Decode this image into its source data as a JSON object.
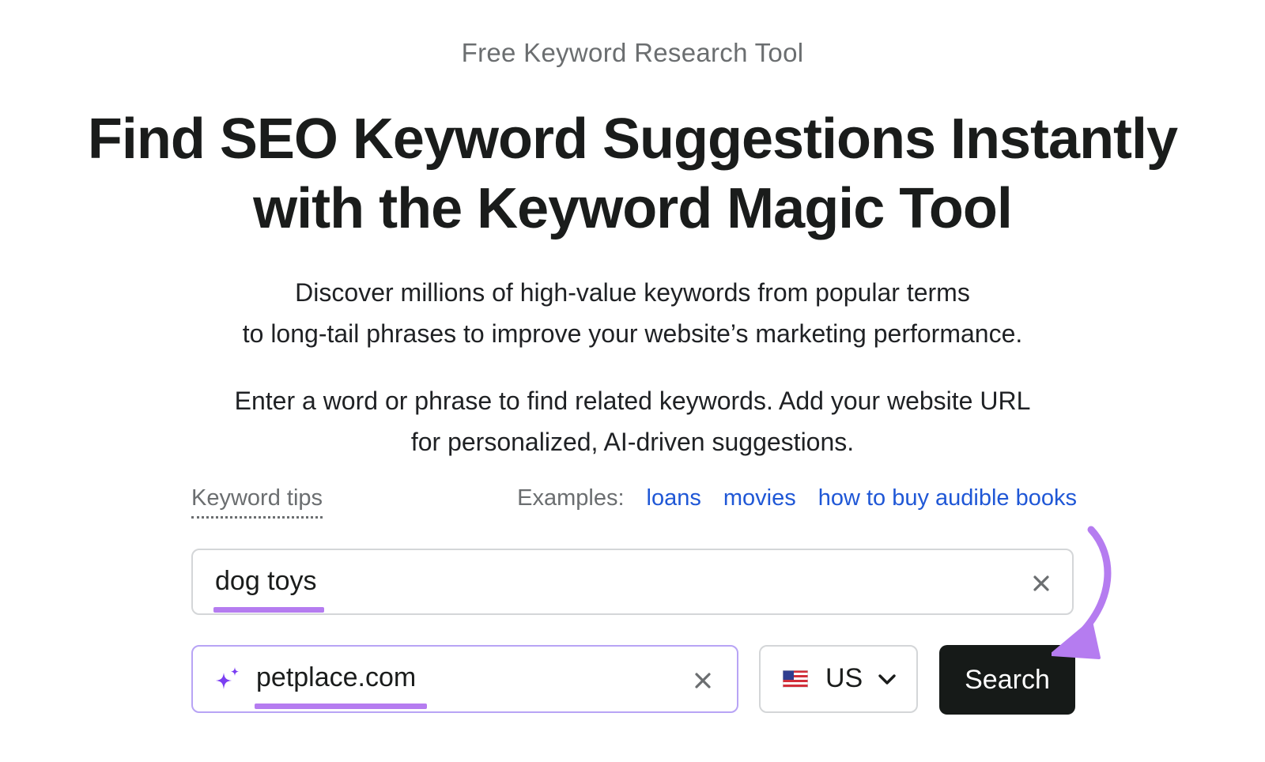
{
  "header": {
    "eyebrow": "Free Keyword Research Tool",
    "headline_line1": "Find SEO Keyword Suggestions Instantly",
    "headline_line2": "with the Keyword Magic Tool",
    "description_line1": "Discover millions of high-value keywords from popular terms",
    "description_line2": "to long-tail phrases to improve your website’s marketing performance.",
    "instruction_line1": "Enter a word or phrase to find related keywords. Add your website URL",
    "instruction_line2": "for personalized, AI-driven suggestions."
  },
  "tips": {
    "keyword_tips_label": "Keyword tips",
    "examples_label": "Examples:",
    "examples": [
      "loans",
      "movies",
      "how to buy audible books"
    ]
  },
  "form": {
    "keyword_value": "dog toys",
    "url_value": "petplace.com",
    "country_value": "US",
    "search_label": "Search",
    "icons": {
      "clear": "close-icon",
      "ai": "sparkle-icon",
      "flag": "us-flag-icon",
      "dropdown": "chevron-down-icon"
    }
  },
  "colors": {
    "accent_purple": "#b57cf0",
    "link_blue": "#1f57d6",
    "button_dark": "#161a18",
    "focus_border": "#b8a4f5",
    "sparkle": "#7b3ff2"
  }
}
